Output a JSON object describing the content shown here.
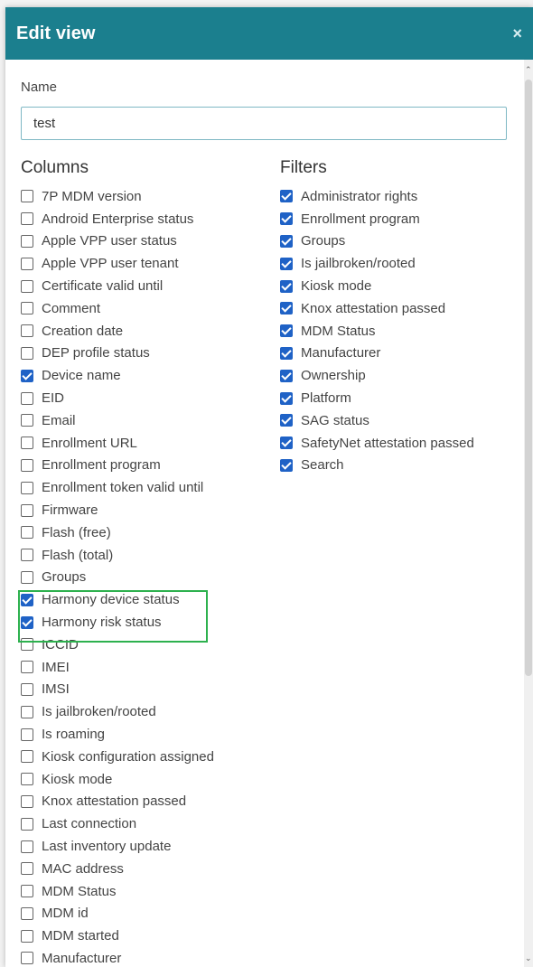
{
  "dialog": {
    "title": "Edit view",
    "close_glyph": "×",
    "name_label": "Name",
    "name_value": "test"
  },
  "columns": {
    "title": "Columns",
    "items": [
      {
        "label": "7P MDM version",
        "checked": false
      },
      {
        "label": "Android Enterprise status",
        "checked": false
      },
      {
        "label": "Apple VPP user status",
        "checked": false
      },
      {
        "label": "Apple VPP user tenant",
        "checked": false
      },
      {
        "label": "Certificate valid until",
        "checked": false
      },
      {
        "label": "Comment",
        "checked": false
      },
      {
        "label": "Creation date",
        "checked": false
      },
      {
        "label": "DEP profile status",
        "checked": false
      },
      {
        "label": "Device name",
        "checked": true
      },
      {
        "label": "EID",
        "checked": false
      },
      {
        "label": "Email",
        "checked": false
      },
      {
        "label": "Enrollment URL",
        "checked": false
      },
      {
        "label": "Enrollment program",
        "checked": false
      },
      {
        "label": "Enrollment token valid until",
        "checked": false
      },
      {
        "label": "Firmware",
        "checked": false
      },
      {
        "label": "Flash (free)",
        "checked": false
      },
      {
        "label": "Flash (total)",
        "checked": false
      },
      {
        "label": "Groups",
        "checked": false
      },
      {
        "label": "Harmony device status",
        "checked": true
      },
      {
        "label": "Harmony risk status",
        "checked": true
      },
      {
        "label": "ICCID",
        "checked": false
      },
      {
        "label": "IMEI",
        "checked": false
      },
      {
        "label": "IMSI",
        "checked": false
      },
      {
        "label": "Is jailbroken/rooted",
        "checked": false
      },
      {
        "label": "Is roaming",
        "checked": false
      },
      {
        "label": "Kiosk configuration assigned",
        "checked": false
      },
      {
        "label": "Kiosk mode",
        "checked": false
      },
      {
        "label": "Knox attestation passed",
        "checked": false
      },
      {
        "label": "Last connection",
        "checked": false
      },
      {
        "label": "Last inventory update",
        "checked": false
      },
      {
        "label": "MAC address",
        "checked": false
      },
      {
        "label": "MDM Status",
        "checked": false
      },
      {
        "label": "MDM id",
        "checked": false
      },
      {
        "label": "MDM started",
        "checked": false
      },
      {
        "label": "Manufacturer",
        "checked": false
      }
    ]
  },
  "filters": {
    "title": "Filters",
    "items": [
      {
        "label": "Administrator rights",
        "checked": true
      },
      {
        "label": "Enrollment program",
        "checked": true
      },
      {
        "label": "Groups",
        "checked": true
      },
      {
        "label": "Is jailbroken/rooted",
        "checked": true
      },
      {
        "label": "Kiosk mode",
        "checked": true
      },
      {
        "label": "Knox attestation passed",
        "checked": true
      },
      {
        "label": "MDM Status",
        "checked": true
      },
      {
        "label": "Manufacturer",
        "checked": true
      },
      {
        "label": "Ownership",
        "checked": true
      },
      {
        "label": "Platform",
        "checked": true
      },
      {
        "label": "SAG status",
        "checked": true
      },
      {
        "label": "SafetyNet attestation passed",
        "checked": true
      },
      {
        "label": "Search",
        "checked": true
      }
    ]
  },
  "colors": {
    "header": "#1b7f8e",
    "checkbox_checked": "#1f62c6",
    "highlight": "#2db14e"
  },
  "scrollbar": {
    "up_glyph": "⌃",
    "down_glyph": "⌄"
  }
}
